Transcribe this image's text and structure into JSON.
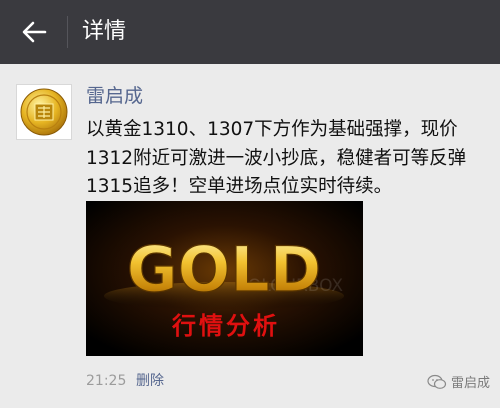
{
  "header": {
    "title": "详情",
    "back_icon": "arrow-left-icon"
  },
  "post": {
    "author": "雷启成",
    "avatar_icon": "gold-coin-avatar",
    "lines": [
      "以黄金1310、1307下方作为基础强撑，现价",
      "1312附近可激进一波小抄底，稳健者可等反弹",
      "1315追多！空单进场点位实时待续。"
    ],
    "image": {
      "big_text": "GOLD",
      "caption": "行情分析",
      "faint_watermark": "COLOURBOX"
    },
    "time": "21:25",
    "delete_label": "删除"
  },
  "watermark": {
    "text": "雷启成",
    "icon": "wechat-logo-icon"
  },
  "colors": {
    "topbar": "#3a3a3f",
    "background": "#ebebeb",
    "link": "#56678f",
    "caption_red": "#e01010",
    "gold": "#e8b020"
  }
}
